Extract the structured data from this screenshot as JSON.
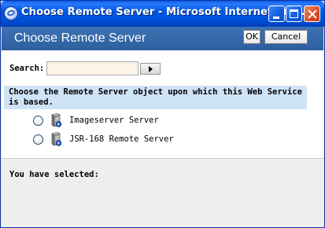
{
  "window": {
    "title": "Choose Remote Server - Microsoft Internet Expl...",
    "icon": "internet-explorer-icon"
  },
  "header": {
    "title": "Choose Remote Server",
    "ok_label": "OK",
    "cancel_label": "Cancel"
  },
  "search": {
    "label": "Search:",
    "value": "",
    "placeholder": "",
    "go_icon": "play-arrow-icon"
  },
  "instruction": "Choose the Remote Server object upon which this Web Service is based.",
  "options": [
    {
      "label": "Imageserver Server",
      "icon": "server-icon",
      "selected": false
    },
    {
      "label": "JSR-168 Remote Server",
      "icon": "server-icon",
      "selected": false
    }
  ],
  "selection": {
    "label": "You have selected:"
  },
  "colors": {
    "titlebar": "#0058e6",
    "header": "#2c5f9f",
    "instruction_bg": "#cfe3f7",
    "search_bg": "#fdf3e6",
    "selected_bg": "#eeeeee"
  }
}
